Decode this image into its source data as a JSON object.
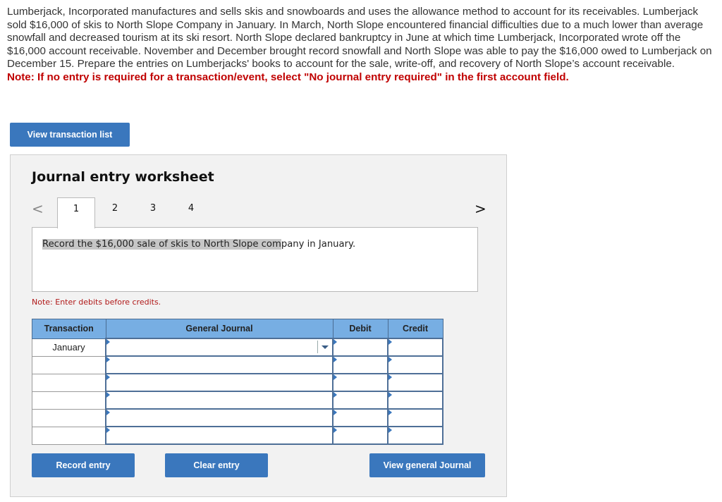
{
  "problem": {
    "text": "Lumberjack, Incorporated manufactures and sells skis and snowboards and uses the allowance method to account for its receivables. Lumberjack sold $16,000 of skis to North Slope Company in January. In March, North Slope encountered financial difficulties due to a much lower than average snowfall and decreased tourism at its ski resort. North Slope declared bankruptcy in June at which time Lumberjack, Incorporated wrote off the $16,000 account receivable. November and December brought record snowfall and North Slope was able to pay the $16,000 owed to Lumberjack on December 15. Prepare the entries on Lumberjacks' books to account for the sale, write-off, and recovery of North Slope’s account receivable.",
    "note": "Note: If no entry is required for a transaction/event, select \"No journal entry required\" in the first account field."
  },
  "buttons": {
    "view_transaction_list": "View transaction list",
    "record_entry": "Record entry",
    "clear_entry": "Clear entry",
    "view_general_journal": "View general Journal"
  },
  "worksheet": {
    "title": "Journal entry worksheet",
    "nav_prev": "<",
    "nav_next": ">",
    "tabs": [
      "1",
      "2",
      "3",
      "4"
    ],
    "active_tab": "1",
    "description_highlighted": "Record the $16,000 sale of skis to North Slope com",
    "description_rest": "pany in January.",
    "debit_note": "Note: Enter debits before credits."
  },
  "table": {
    "headers": [
      "Transaction",
      "General Journal",
      "Debit",
      "Credit"
    ],
    "rows": [
      {
        "transaction": "January",
        "account": "",
        "debit": "",
        "credit": ""
      },
      {
        "transaction": "",
        "account": "",
        "debit": "",
        "credit": ""
      },
      {
        "transaction": "",
        "account": "",
        "debit": "",
        "credit": ""
      },
      {
        "transaction": "",
        "account": "",
        "debit": "",
        "credit": ""
      },
      {
        "transaction": "",
        "account": "",
        "debit": "",
        "credit": ""
      },
      {
        "transaction": "",
        "account": "",
        "debit": "",
        "credit": ""
      }
    ]
  }
}
